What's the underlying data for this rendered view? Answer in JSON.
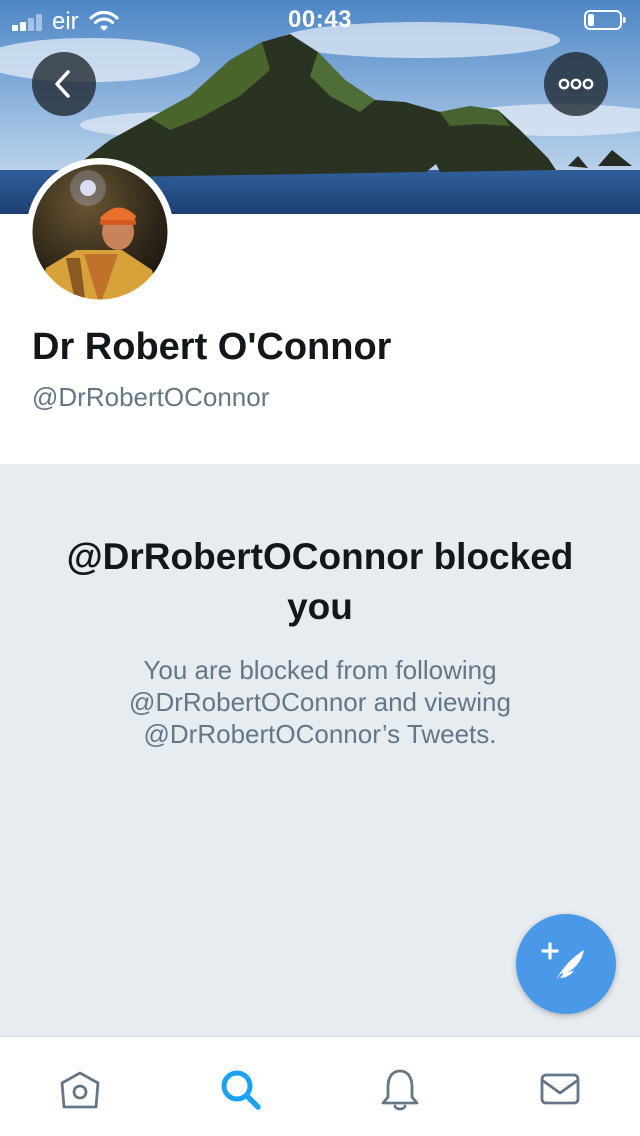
{
  "status_bar": {
    "carrier": "eir",
    "time": "00:43"
  },
  "profile": {
    "display_name": "Dr Robert O'Connor",
    "handle": "@DrRobertOConnor"
  },
  "blocked": {
    "title": "@DrRobertOConnor blocked you",
    "message": "You are blocked from following @DrRobertOConnor and viewing @DrRobertOConnor’s Tweets."
  },
  "tabs": [
    {
      "name": "home",
      "icon": "home-icon",
      "active": false
    },
    {
      "name": "search",
      "icon": "search-icon",
      "active": true
    },
    {
      "name": "notifications",
      "icon": "bell-icon",
      "active": false
    },
    {
      "name": "messages",
      "icon": "mail-icon",
      "active": false
    }
  ],
  "colors": {
    "accent": "#1da1f2",
    "fab": "#4a99e9",
    "panel_background": "#e6ecf0",
    "muted_text": "#657786",
    "inactive_icon": "#657786"
  }
}
